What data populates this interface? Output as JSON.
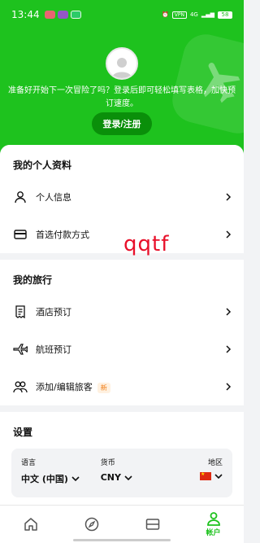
{
  "status_bar": {
    "time": "13:44",
    "vpn_label": "VPN",
    "network": "4G",
    "battery": "58"
  },
  "header": {
    "prompt": "准备好开始下一次冒险了吗？登录后即可轻松填写表格，加快预订速度。",
    "login_button": "登录/注册"
  },
  "profile_section": {
    "title": "我的个人资料",
    "items": [
      {
        "label": "个人信息",
        "icon": "person-icon"
      },
      {
        "label": "首选付款方式",
        "icon": "credit-card-icon"
      }
    ]
  },
  "trips_section": {
    "title": "我的旅行",
    "items": [
      {
        "label": "酒店预订",
        "icon": "hotel-receipt-icon"
      },
      {
        "label": "航班预订",
        "icon": "plane-icon"
      },
      {
        "label": "添加/编辑旅客",
        "icon": "travellers-icon",
        "badge": "新"
      }
    ]
  },
  "settings_section": {
    "title": "设置",
    "language": {
      "label": "语言",
      "value": "中文 (中国)"
    },
    "currency": {
      "label": "货币",
      "value": "CNY"
    },
    "region": {
      "label": "地区",
      "flag": "cn-flag"
    }
  },
  "watermark": "qqtf",
  "tabbar": {
    "tabs": [
      {
        "icon": "home-icon",
        "label": ""
      },
      {
        "icon": "compass-icon",
        "label": ""
      },
      {
        "icon": "bookings-icon",
        "label": ""
      },
      {
        "icon": "account-icon",
        "label": "帐户",
        "active": true
      }
    ]
  },
  "colors": {
    "brand_green": "#1ec21e",
    "dark_green": "#0a8f0a",
    "badge_orange": "#f07b14"
  }
}
